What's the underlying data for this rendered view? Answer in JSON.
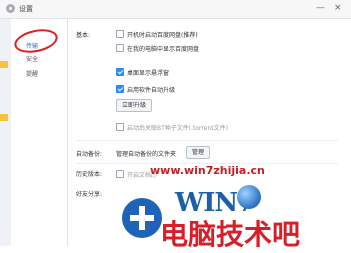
{
  "window": {
    "title": "设置",
    "minimize_glyph": "—",
    "close_glyph": "×"
  },
  "sidebar": {
    "items": [
      {
        "label": "传输",
        "active": true
      },
      {
        "label": "安全",
        "active": false
      },
      {
        "label": "提醒",
        "active": false
      }
    ]
  },
  "basic": {
    "label": "基本:",
    "options": [
      {
        "text": "开机时启动百度网盘(推荐)",
        "checked": false,
        "disabled": false
      },
      {
        "text": "在我的电脑中显示百度网盘",
        "checked": false,
        "disabled": false
      },
      {
        "text": "桌面显示悬浮窗",
        "checked": true,
        "disabled": false
      },
      {
        "text": "启用软件自动升级",
        "checked": true,
        "disabled": false
      }
    ],
    "upgrade_button": "立即升级",
    "bt_option": {
      "text": "启动后关联BT种子文件(.torrent文件)",
      "checked": false,
      "disabled": true
    }
  },
  "auto_backup": {
    "label": "自动备份:",
    "text": "管理自动备份的文件夹",
    "button": "管理"
  },
  "history": {
    "label": "历史版本:",
    "option_text": "开启文档历",
    "checked": false
  },
  "sharing": {
    "label": "好友分享:"
  },
  "watermark": {
    "url": "www.win7zhijia.cn",
    "win": "WIN7",
    "big": "电脑技术吧"
  },
  "colors": {
    "accent": "#2d8cf0",
    "highlight_circle": "#e02020",
    "watermark_red": "#d61f26"
  },
  "icons": {
    "app": "gear-icon",
    "minimize": "minimize-icon",
    "close": "close-icon"
  }
}
